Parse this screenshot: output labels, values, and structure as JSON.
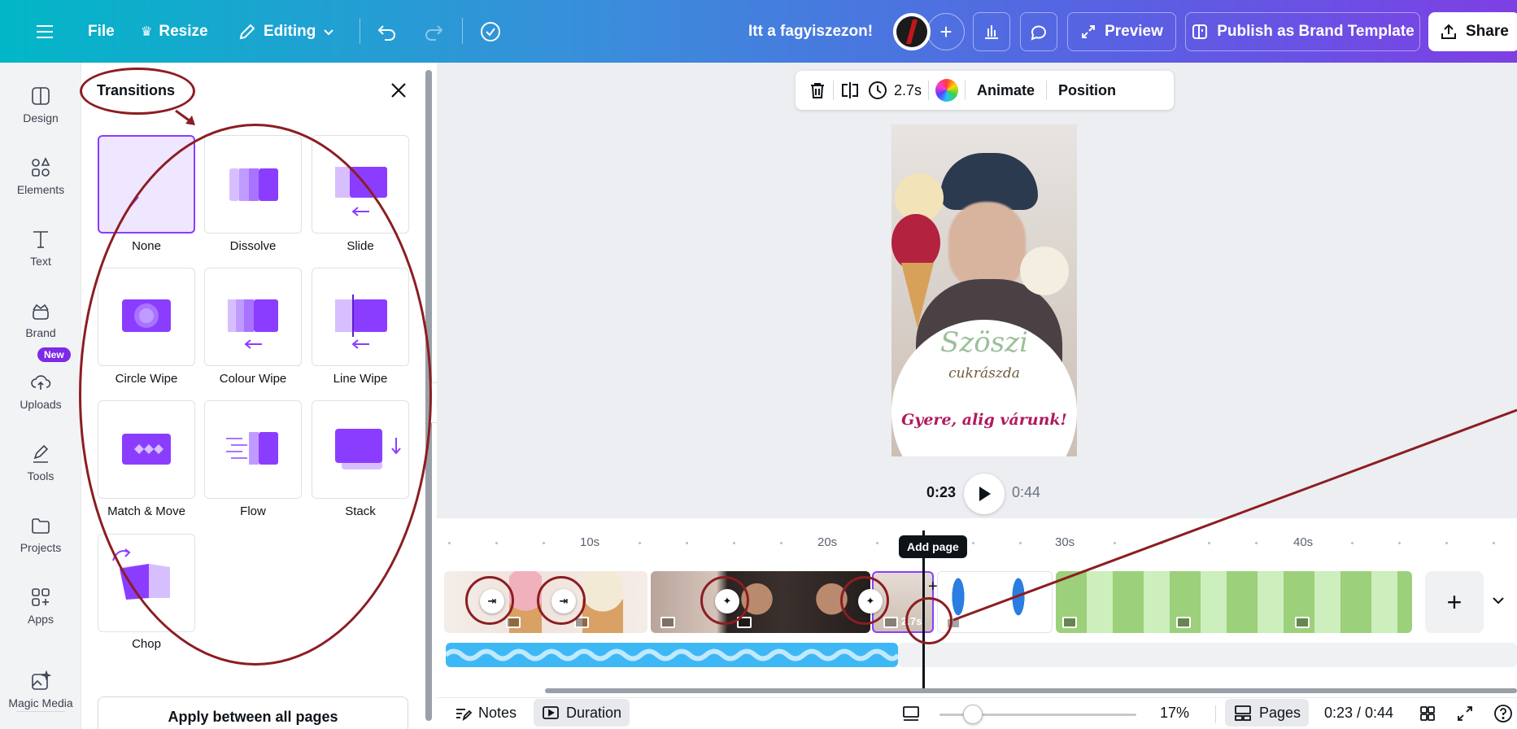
{
  "topbar": {
    "file_label": "File",
    "resize_label": "Resize",
    "editing_label": "Editing",
    "doc_title": "Itt a fagyiszezon!",
    "preview_label": "Preview",
    "publish_label": "Publish as Brand Template",
    "share_label": "Share"
  },
  "rail": {
    "items": [
      "Design",
      "Elements",
      "Text",
      "Brand",
      "Uploads",
      "Tools",
      "Projects",
      "Apps",
      "Magic Media"
    ],
    "new_badge": "New"
  },
  "panel": {
    "title": "Transitions",
    "tiles": [
      "None",
      "Dissolve",
      "Slide",
      "Circle Wipe",
      "Colour Wipe",
      "Line Wipe",
      "Match & Move",
      "Flow",
      "Stack",
      "Chop"
    ],
    "apply_label": "Apply between all pages"
  },
  "context_bar": {
    "duration": "2.7s",
    "animate_label": "Animate",
    "position_label": "Position"
  },
  "poster": {
    "logo_line1": "Szöszi",
    "logo_line2": "cukrászda",
    "tagline": "Gyere, alig várunk!"
  },
  "player": {
    "current_time": "0:23",
    "total_time": "0:44"
  },
  "timeline": {
    "ruler_labels": [
      "10s",
      "20s",
      "30s",
      "40s"
    ],
    "add_page_tooltip": "Add page",
    "clip_duration": "2.7s"
  },
  "bottombar": {
    "notes_label": "Notes",
    "duration_label": "Duration",
    "zoom_percent": "17%",
    "zoom_level": 0.17,
    "pages_label": "Pages",
    "time_readout": "0:23 / 0:44"
  },
  "colors": {
    "brand_purple": "#8b3dff",
    "annotation_red": "#8c1d22",
    "audio_blue": "#3eb8f5"
  }
}
